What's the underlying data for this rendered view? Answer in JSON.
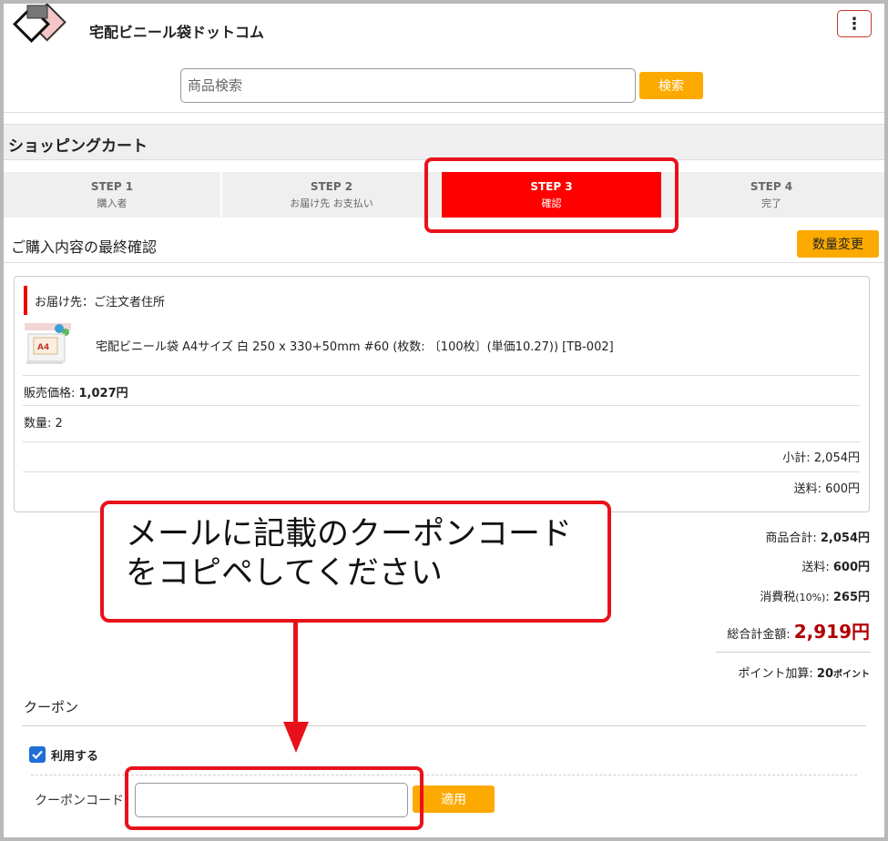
{
  "header": {
    "site_title": "宅配ビニール袋ドットコム",
    "menu_glyph": "⋮"
  },
  "search": {
    "placeholder": "商品検索",
    "button_label": "検索"
  },
  "cart": {
    "title": "ショッピングカート"
  },
  "steps": [
    {
      "title": "STEP 1",
      "subtitle": "購入者",
      "active": false
    },
    {
      "title": "STEP 2",
      "subtitle": "お届け先 お支払い",
      "active": false
    },
    {
      "title": "STEP 3",
      "subtitle": "確認",
      "active": true
    },
    {
      "title": "STEP 4",
      "subtitle": "完了",
      "active": false
    }
  ],
  "confirm": {
    "title": "ご購入内容の最終確認",
    "qty_change_label": "数量変更"
  },
  "order": {
    "destination": "お届け先：ご注文者住所",
    "product_name": "宅配ビニール袋 A4サイズ 白 250 x 330+50mm #60 (枚数: 〔100枚〕(単価10.27)) [TB-002]",
    "price_label": "販売価格: ",
    "price_value": "1,027円",
    "qty_label": "数量: 2",
    "subtotal": "小計: 2,054円",
    "shipping": "送料: 600円"
  },
  "totals": {
    "items_label": "商品合計: ",
    "items_value": "2,054円",
    "shipping_label": "送料: ",
    "shipping_value": "600円",
    "tax_label": "消費税",
    "tax_rate": "(10%)",
    "tax_sep": ": ",
    "tax_value": "265円",
    "grand_label": "総合計金額: ",
    "grand_value": "2,919円",
    "points_label": "ポイント加算: ",
    "points_value": "20",
    "points_unit": "ポイント"
  },
  "coupon": {
    "title": "クーポン",
    "use_label": "利用する",
    "use_checked": true,
    "code_label": "クーポンコード",
    "code_value": "",
    "apply_label": "適用"
  },
  "annotation": {
    "line1": "メールに記載のクーポンコード",
    "line2": "をコピペしてください"
  },
  "colors": {
    "accent": "#fcaa00",
    "step_active": "#ff0000",
    "annotation": "#e8111b",
    "grand_total": "#b00000"
  }
}
